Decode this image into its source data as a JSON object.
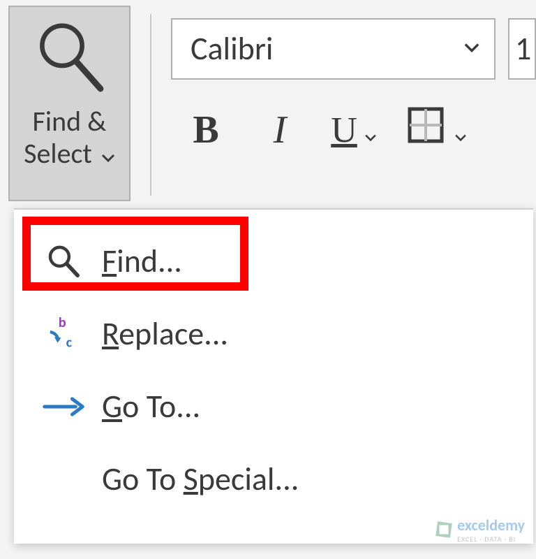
{
  "ribbon": {
    "findSelect": {
      "line1": "Find &",
      "line2": "Select"
    },
    "fontPicker": {
      "selected": "Calibri"
    },
    "sizePicker": {
      "partial": "1"
    },
    "format": {
      "bold": "B",
      "italic": "I",
      "underline": "U"
    }
  },
  "menu": {
    "find": {
      "accel": "F",
      "rest": "ind..."
    },
    "replace": {
      "accel": "R",
      "rest": "eplace..."
    },
    "goto": {
      "accel": "G",
      "rest": "o To..."
    },
    "gotoSpecial": {
      "before": "Go To ",
      "accel": "S",
      "rest": "pecial..."
    }
  },
  "watermark": {
    "brand": "exceldemy",
    "tag": "EXCEL · DATA · BI"
  }
}
